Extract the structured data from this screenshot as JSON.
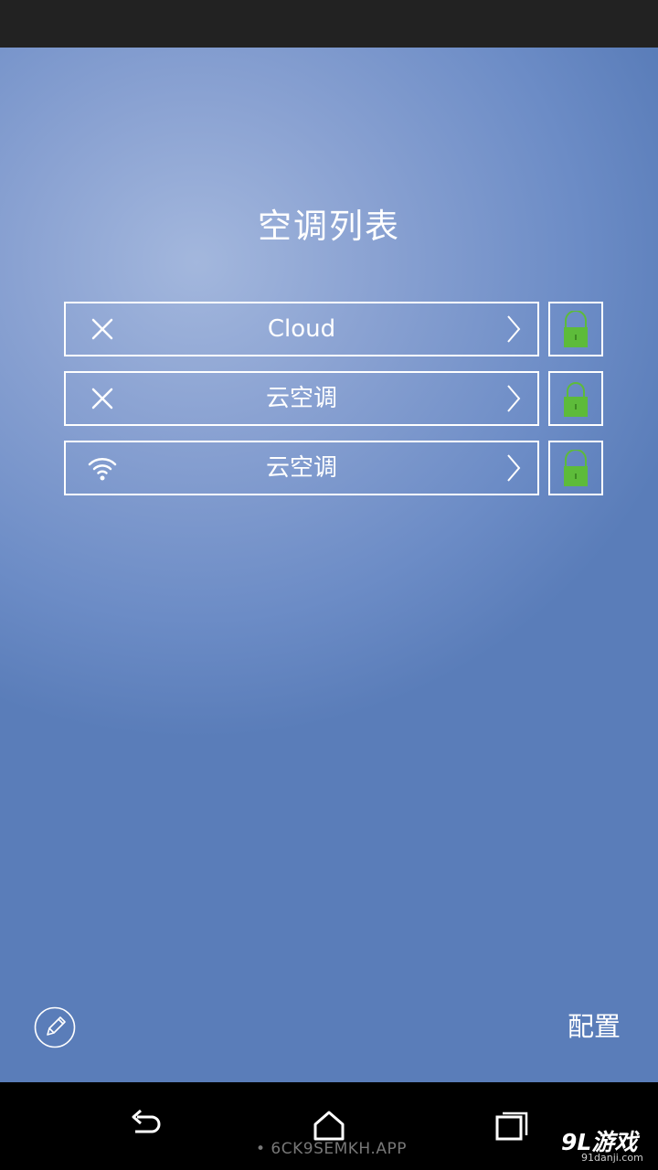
{
  "page": {
    "title": "空调列表"
  },
  "ac_list": [
    {
      "name": "Cloud",
      "status": "disconnected",
      "status_icon": "close-icon",
      "lock_color": "#5dbb3a"
    },
    {
      "name": "云空调",
      "status": "disconnected",
      "status_icon": "close-icon",
      "lock_color": "#5dbb3a"
    },
    {
      "name": "云空调",
      "status": "connected",
      "status_icon": "wifi-icon",
      "lock_color": "#5dbb3a"
    }
  ],
  "footer": {
    "config_label": "配置",
    "edit_icon": "pencil-icon"
  },
  "navigation": {
    "back_icon": "back-icon",
    "home_icon": "home-icon",
    "recent_icon": "recent-apps-icon"
  },
  "watermark": {
    "code": "• 6CK9SEMKH.APP",
    "logo_main": "9L游戏",
    "logo_sub": "91danji.com"
  }
}
